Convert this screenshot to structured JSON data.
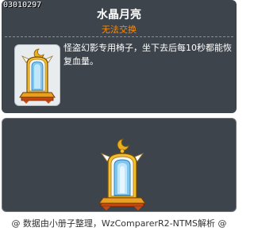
{
  "tooltip": {
    "item_id": "03010297",
    "item_name": "水晶月亮",
    "trade_status": "无法交换",
    "description": "怪盗幻影专用椅子，坐下去后每10秒都能恢复血量。",
    "icon": "crystal-moon-chair-icon"
  },
  "preview": {
    "image": "crystal-moon-chair-preview"
  },
  "footer": {
    "credit": "@ 数据由小册子整理，WzComparerR2-NTMS解析 @"
  },
  "colors": {
    "panel_bg": "#3d444c",
    "trade_status": "#ff8a00",
    "text": "#ffffff"
  }
}
